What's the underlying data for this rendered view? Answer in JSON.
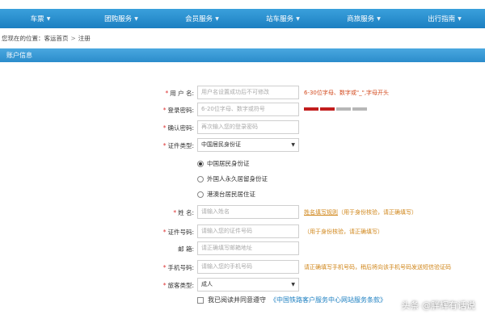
{
  "nav": {
    "items": [
      {
        "label": "车票"
      },
      {
        "label": "团购服务"
      },
      {
        "label": "会员服务"
      },
      {
        "label": "站车服务"
      },
      {
        "label": "商旅服务"
      },
      {
        "label": "出行指南"
      }
    ],
    "caret_icon": "chevron-down-icon"
  },
  "breadcrumb": {
    "prefix": "您现在的位置：",
    "home": "客运首页",
    "separator": ">",
    "current": "注册"
  },
  "section": {
    "title": "账户信息"
  },
  "form": {
    "username": {
      "label": "用 户 名:",
      "placeholder": "用户名设置成功后不可修改",
      "hint": "6-30位字母、数字或\"_\",字母开头"
    },
    "password": {
      "label": "登录密码:",
      "placeholder": "6-20位字母、数字或符号",
      "strength_level": 2,
      "strength_max": 4
    },
    "confirm_password": {
      "label": "确认密码:",
      "placeholder": "再次输入您的登录密码"
    },
    "id_type": {
      "label": "证件类型:",
      "value": "中国居民身份证",
      "options": [
        {
          "label": "中国居民身份证",
          "selected": true
        },
        {
          "label": "外国人永久居留身份证",
          "selected": false
        },
        {
          "label": "港澳台居民居住证",
          "selected": false
        }
      ]
    },
    "name": {
      "label": "姓 名:",
      "placeholder": "请输入姓名",
      "hint_link": "姓名填写规则",
      "hint": "（用于身份核验，请正确填写）"
    },
    "id_number": {
      "label": "证件号码:",
      "placeholder": "请输入您的证件号码",
      "hint": "（用于身份核验，请正确填写）"
    },
    "email": {
      "label": "邮 箱:",
      "placeholder": "请正确填写邮箱地址"
    },
    "phone": {
      "label": "手机号码:",
      "placeholder": "请输入您的手机号码",
      "hint": "请正确填写手机号码，稍后将向该手机号码发送短信验证码"
    },
    "passenger_type": {
      "label": "旅客类型:",
      "value": "成人"
    },
    "agree": {
      "text": "我已阅读并同意遵守",
      "link": "《中国铁路客户服务中心网站服务条款》"
    }
  },
  "watermark": {
    "text": "头条 @胖辉有话说"
  }
}
